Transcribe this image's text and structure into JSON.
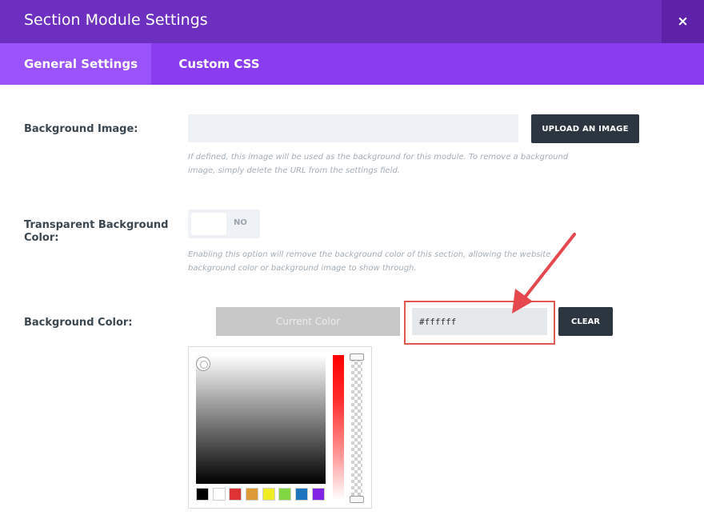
{
  "dialog": {
    "title": "Section Module Settings",
    "close_label": "×"
  },
  "tabs": [
    {
      "label": "General Settings",
      "active": true
    },
    {
      "label": "Custom CSS",
      "active": false
    }
  ],
  "background_image": {
    "label": "Background Image:",
    "value": "",
    "upload_label": "UPLOAD AN IMAGE",
    "description": "If defined, this image will be used as the background for this module. To remove a background image, simply delete the URL from the settings field."
  },
  "transparent_background": {
    "label": "Transparent Background Color:",
    "toggle_text": "NO",
    "description": "Enabling this option will remove the background color of this section, allowing the website background color or background image to show through."
  },
  "background_color": {
    "label": "Background Color:",
    "current_color_label": "Current Color",
    "hex_value": "#ffffff",
    "clear_label": "CLEAR"
  },
  "color_picker": {
    "palette": [
      "#000000",
      "#ffffff",
      "#dd3333",
      "#dd9933",
      "#eeee22",
      "#81d742",
      "#1e73be",
      "#8224e3"
    ]
  },
  "colors": {
    "header": "#6c2fbf",
    "tab_bar": "#8a3df0",
    "tab_active": "#9a52fa",
    "button_dark": "#2b3640",
    "highlight": "#e05850"
  }
}
